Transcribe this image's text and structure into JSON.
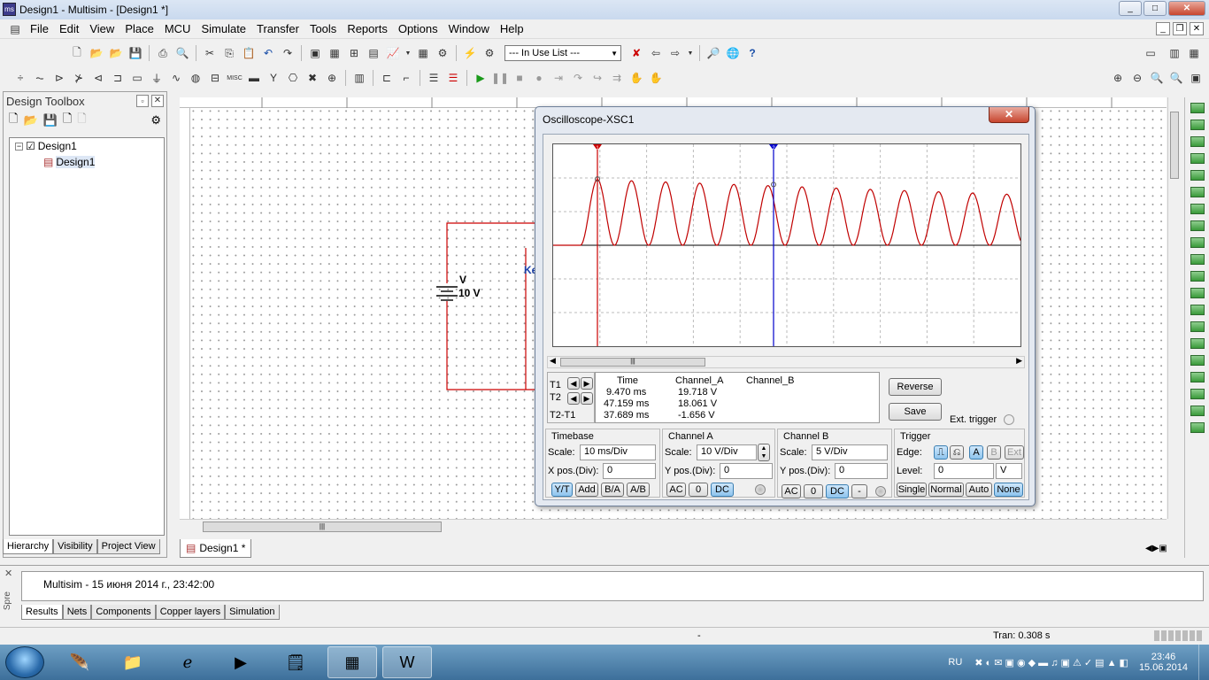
{
  "window": {
    "title": "Design1 - Multisim - [Design1 *]",
    "controls": [
      "_",
      "□",
      "✕"
    ]
  },
  "menu": [
    "File",
    "Edit",
    "View",
    "Place",
    "MCU",
    "Simulate",
    "Transfer",
    "Tools",
    "Reports",
    "Options",
    "Window",
    "Help"
  ],
  "toolbar": {
    "in_use_list": "--- In Use List ---"
  },
  "design_toolbox": {
    "title": "Design Toolbox",
    "tree": [
      {
        "label": "Design1"
      },
      {
        "label": "Design1"
      }
    ],
    "tabs": [
      "Hierarchy",
      "Visibility",
      "Project View"
    ]
  },
  "schematic": {
    "source_label": "V",
    "source_value": "10 V",
    "partial_label": "Ke",
    "tab": "Design1 *"
  },
  "oscilloscope": {
    "title": "Oscilloscope-XSC1",
    "cursor_markers": [
      "1",
      "2"
    ],
    "readout": {
      "headers": [
        "Time",
        "Channel_A",
        "Channel_B"
      ],
      "rows": [
        {
          "label": "T1",
          "time": "9.470 ms",
          "a": "19.718 V",
          "b": ""
        },
        {
          "label": "T2",
          "time": "47.159 ms",
          "a": "18.061 V",
          "b": ""
        },
        {
          "label": "T2-T1",
          "time": "37.689 ms",
          "a": "-1.656 V",
          "b": ""
        }
      ]
    },
    "buttons": {
      "reverse": "Reverse",
      "save": "Save",
      "ext_trigger": "Ext. trigger"
    },
    "timebase": {
      "title": "Timebase",
      "scale_label": "Scale:",
      "scale": "10 ms/Div",
      "xpos_label": "X pos.(Div):",
      "xpos": "0",
      "modes": [
        "Y/T",
        "Add",
        "B/A",
        "A/B"
      ]
    },
    "channel_a": {
      "title": "Channel A",
      "scale_label": "Scale:",
      "scale": "10  V/Div",
      "ypos_label": "Y pos.(Div):",
      "ypos": "0",
      "coupling": [
        "AC",
        "0",
        "DC"
      ]
    },
    "channel_b": {
      "title": "Channel B",
      "scale_label": "Scale:",
      "scale": "5  V/Div",
      "ypos_label": "Y pos.(Div):",
      "ypos": "0",
      "coupling": [
        "AC",
        "0",
        "DC",
        "-"
      ]
    },
    "trigger": {
      "title": "Trigger",
      "edge_label": "Edge:",
      "sources": [
        "A",
        "B",
        "Ext"
      ],
      "level_label": "Level:",
      "level": "0",
      "level_unit": "V",
      "modes": [
        "Single",
        "Normal",
        "Auto",
        "None"
      ]
    }
  },
  "output": {
    "side_label": "Spre",
    "message": "Multisim  -  15 июня 2014 г., 23:42:00",
    "tabs": [
      "Results",
      "Nets",
      "Components",
      "Copper layers",
      "Simulation"
    ]
  },
  "status": {
    "center": "-",
    "tran": "Tran: 0.308 s"
  },
  "taskbar": {
    "lang": "RU",
    "time": "23:46",
    "date": "15.06.2014"
  },
  "colors": {
    "trace": "#c00000",
    "cursor1": "#cc0000",
    "cursor2": "#0000cc",
    "wire": "#cc0000"
  }
}
